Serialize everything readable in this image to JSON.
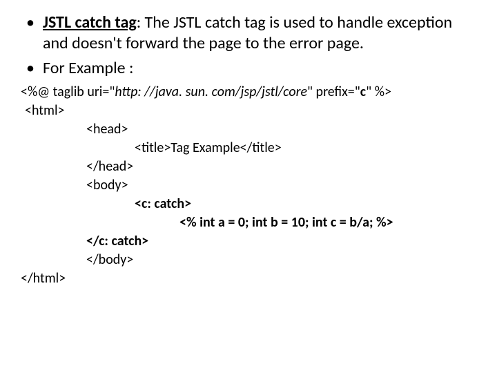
{
  "bullets": {
    "b1_term": "JSTL catch tag",
    "b1_rest": ": The JSTL catch tag is used to handle exception and doesn't forward the page to the error page.",
    "b2": "For Example :"
  },
  "code": {
    "l1a": "<%@ taglib uri=\"",
    "l1b": "http: //java. sun. com/jsp/jstl/core",
    "l1c": "\" prefix=\"",
    "l1d": "c",
    "l1e": "\" %>",
    "l2": "<html>",
    "l3": "<head>",
    "l4": "<title>Tag Example</title>",
    "l5": "</head>",
    "l6": "<body>",
    "l7": "<c: catch>",
    "l8": "<% int a = 0; int b = 10; int c = b/a; %>",
    "l9": "</c: catch>",
    "l10": "</body>",
    "l11": "</html>"
  }
}
